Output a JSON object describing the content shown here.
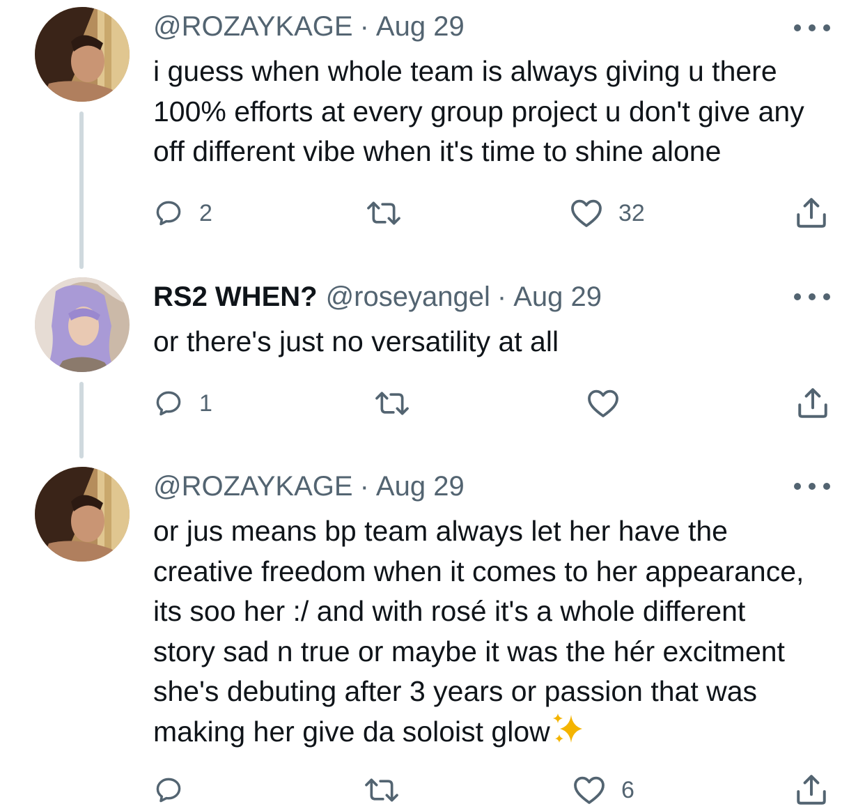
{
  "tweets": [
    {
      "name": "",
      "handle": "@ROZAYKAGE",
      "date": "Aug 29",
      "text": "i guess when whole team is always giving u there\n100% efforts at every group project u don't give any\noff different vibe when it's time to shine alone",
      "counts": {
        "reply": "2",
        "retweet": "",
        "like": "32"
      },
      "avatar_icon": "avatar-dark-hair"
    },
    {
      "name": "RS2 WHEN?",
      "handle": "@roseyangel",
      "date": "Aug 29",
      "text": "or there's just no versatility at all",
      "counts": {
        "reply": "1",
        "retweet": "",
        "like": ""
      },
      "avatar_icon": "avatar-purple-hair"
    },
    {
      "name": "",
      "handle": "@ROZAYKAGE",
      "date": "Aug 29",
      "text": "or jus means bp team always let her have the\ncreative freedom when it comes to her appearance,\nits soo her :/ and with rosé it's a whole different\nstory sad n true or maybe it was the hér excitment\nshe's debuting after 3 years or passion that was\nmaking her give da soloist glow",
      "counts": {
        "reply": "",
        "retweet": "",
        "like": "6"
      },
      "avatar_icon": "avatar-dark-hair",
      "emoji": "sparkles-icon"
    }
  ],
  "separator": "·",
  "colors": {
    "text": "#0f1419",
    "secondary": "#536471",
    "thread_line": "#cfd9de",
    "sparkle": "#f4b400"
  }
}
